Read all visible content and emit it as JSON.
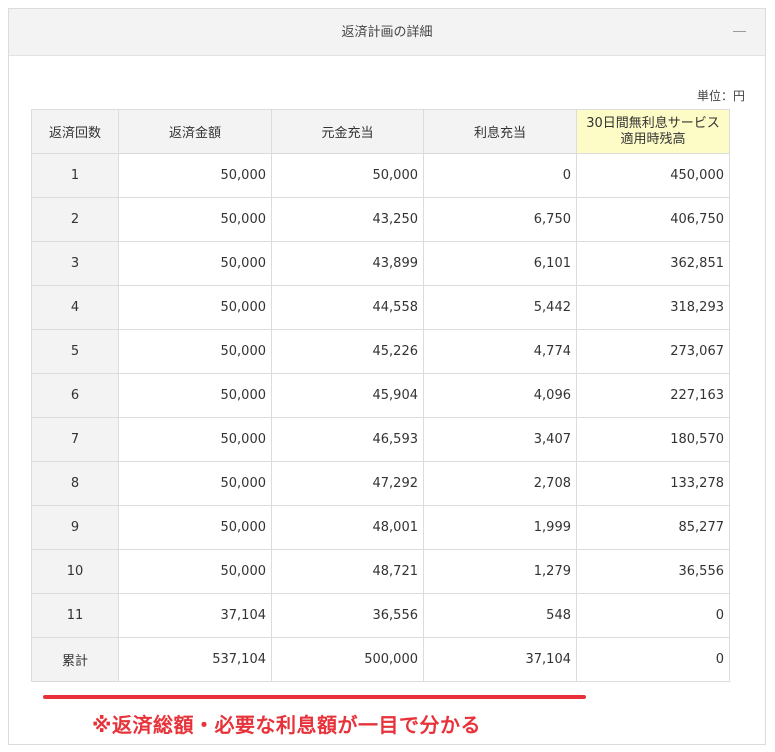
{
  "panel": {
    "title": "返済計画の詳細",
    "collapse_icon": "minus-icon"
  },
  "unit_label": "単位：円",
  "table": {
    "headers": [
      "返済回数",
      "返済金額",
      "元金充当",
      "利息充当",
      "30日間無利息サービス適用時残高"
    ],
    "header_last_lines": [
      "30日間無利息サービス",
      "適用時残高"
    ],
    "rows": [
      [
        "1",
        "50,000",
        "50,000",
        "0",
        "450,000"
      ],
      [
        "2",
        "50,000",
        "43,250",
        "6,750",
        "406,750"
      ],
      [
        "3",
        "50,000",
        "43,899",
        "6,101",
        "362,851"
      ],
      [
        "4",
        "50,000",
        "44,558",
        "5,442",
        "318,293"
      ],
      [
        "5",
        "50,000",
        "45,226",
        "4,774",
        "273,067"
      ],
      [
        "6",
        "50,000",
        "45,904",
        "4,096",
        "227,163"
      ],
      [
        "7",
        "50,000",
        "46,593",
        "3,407",
        "180,570"
      ],
      [
        "8",
        "50,000",
        "47,292",
        "2,708",
        "133,278"
      ],
      [
        "9",
        "50,000",
        "48,001",
        "1,999",
        "85,277"
      ],
      [
        "10",
        "50,000",
        "48,721",
        "1,279",
        "36,556"
      ],
      [
        "11",
        "37,104",
        "36,556",
        "548",
        "0"
      ]
    ],
    "total": [
      "累計",
      "537,104",
      "500,000",
      "37,104",
      "0"
    ]
  },
  "note": "※返済総額・必要な利息額が一目で分かる",
  "colors": {
    "header_bg": "#f3f3f3",
    "highlight_header_bg": "#fdfbc6",
    "accent_red": "#e8323a",
    "border": "#dcdcdc"
  }
}
